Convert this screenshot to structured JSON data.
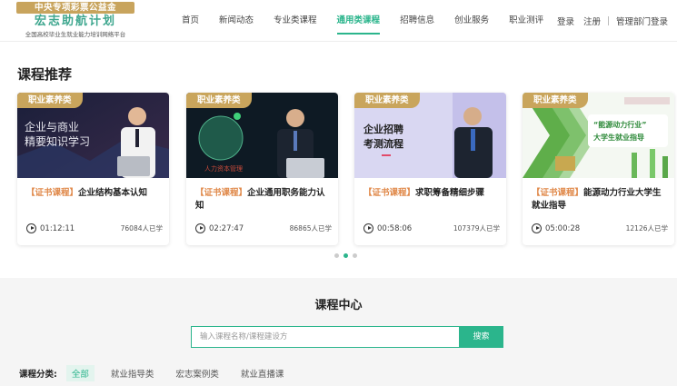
{
  "logo": {
    "top": "中央专项彩票公益金",
    "main": "宏志助航计划",
    "sub": "全国高校毕业生就业能力培训网络平台"
  },
  "nav": [
    {
      "label": "首页",
      "active": false
    },
    {
      "label": "新闻动态",
      "active": false
    },
    {
      "label": "专业类课程",
      "active": false
    },
    {
      "label": "通用类课程",
      "active": true
    },
    {
      "label": "招聘信息",
      "active": false
    },
    {
      "label": "创业服务",
      "active": false
    },
    {
      "label": "职业测评",
      "active": false
    }
  ],
  "account": {
    "login": "登录",
    "register": "注册",
    "admin_login": "管理部门登录"
  },
  "recommend": {
    "title": "课程推荐",
    "cards": [
      {
        "tag": "职业素养类",
        "thumb_text": [
          "企业与商业",
          "精要知识学习"
        ],
        "cert": "【证书课程】",
        "title": "企业结构基本认知",
        "duration": "01:12:11",
        "learners": "76084人已学"
      },
      {
        "tag": "职业素养类",
        "thumb_text": [
          "人力资本管理"
        ],
        "cert": "【证书课程】",
        "title": "企业通用职务能力认知",
        "duration": "02:27:47",
        "learners": "86865人已学"
      },
      {
        "tag": "职业素养类",
        "thumb_text": [
          "企业招聘",
          "考测流程"
        ],
        "cert": "【证书课程】",
        "title": "求职筹备精细步骤",
        "duration": "00:58:06",
        "learners": "107379人已学"
      },
      {
        "tag": "职业素养类",
        "thumb_text": [
          "“能源动力行业”",
          "大学生就业指导"
        ],
        "cert": "【证书课程】",
        "title": "能源动力行业大学生就业指导",
        "duration": "05:00:28",
        "learners": "12126人已学"
      }
    ],
    "carousel_active_index": 1
  },
  "course_center": {
    "title": "课程中心",
    "search_placeholder": "输入课程名称/课程建设方",
    "search_button": "搜索",
    "category_label": "课程分类:",
    "categories": [
      {
        "label": "全部",
        "active": true
      },
      {
        "label": "就业指导类",
        "active": false
      },
      {
        "label": "宏志案例类",
        "active": false
      },
      {
        "label": "就业直播课",
        "active": false
      }
    ]
  },
  "colors": {
    "accent": "#2bb58c",
    "tag_gold": "#c9a55c",
    "cert_orange": "#e0894a"
  }
}
